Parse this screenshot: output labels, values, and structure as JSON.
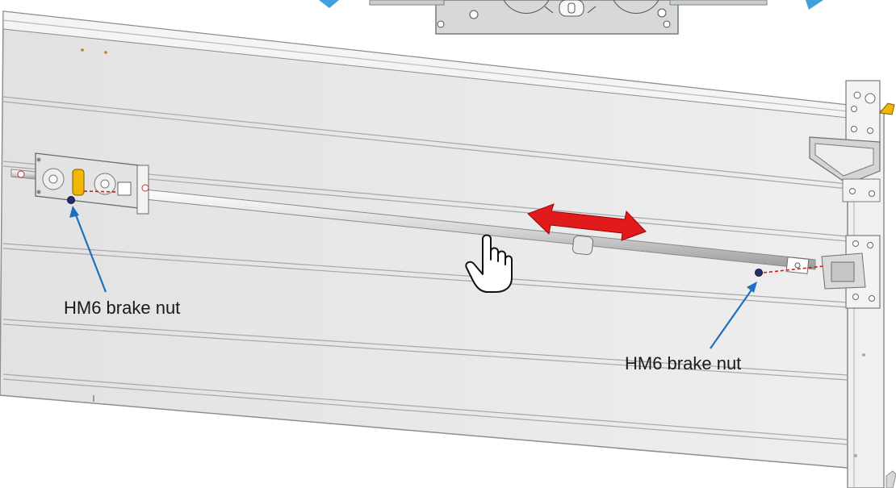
{
  "labels": {
    "left_callout": "HM6 brake nut",
    "right_callout": "HM6 brake nut"
  },
  "colors": {
    "panel_fill": "#e9e9e9",
    "panel_stroke": "#9a9a9a",
    "callout_arrow": "#1f6fc1",
    "motion_arrow": "#e11b1b",
    "nav_arrow": "#3fa0dc",
    "lock_accent": "#f2b705"
  },
  "icons": {
    "hand": "hand-pointer-icon",
    "motion": "double-arrow-icon",
    "nav_prev": "previous-arrow-icon",
    "nav_next": "next-arrow-icon"
  }
}
